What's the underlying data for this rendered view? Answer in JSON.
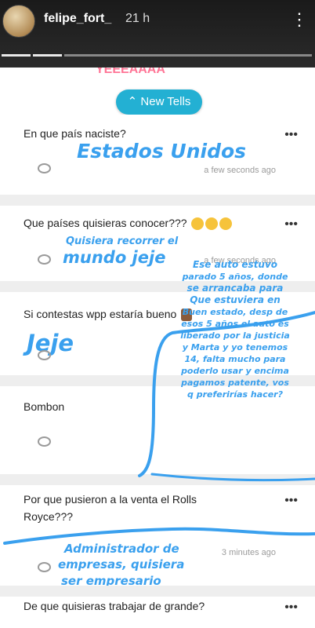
{
  "header": {
    "username": "felipe_fort_",
    "time": "21 h",
    "more_icon": "⋮"
  },
  "feed": {
    "top_fragment": "YEEEAAAA",
    "new_tells_label": "New Tells",
    "more_icon": "•••",
    "items": [
      {
        "question": "En que país naciste?",
        "answer": "Estados Unidos",
        "timestamp": "a few seconds ago"
      },
      {
        "question": "Que países quisieras conocer???",
        "answer_line1": "Quisiera recorrer el",
        "answer_line2": "mundo jeje",
        "timestamp": "a few seconds ago"
      },
      {
        "question": "Si contestas wpp estaría bueno",
        "answer": "Jeje"
      },
      {
        "question": "Bombon"
      },
      {
        "question_line1": "Por que pusieron a la venta el Rolls",
        "question_line2": "Royce???",
        "answer_line1": "Administrador de",
        "answer_line2": "empresas, quisiera",
        "answer_line3": "ser empresario",
        "timestamp": "3 minutes ago"
      },
      {
        "question": "De que quisieras trabajar de grande?"
      }
    ],
    "overlay_note": {
      "line1": "Ese auto estuvo",
      "line2": "parado 5 años, donde",
      "line3": "se arrancaba para",
      "line4": "Que estuviera en",
      "line5": "Buen estado, desp de",
      "line6": "esos 5 años el auto es",
      "line7": "liberado por la justicia",
      "line8": "y Marta y yo tenemos",
      "line9": "14, falta mucho para",
      "line10": "poderlo usar y encima",
      "line11": "pagamos patente, vos",
      "line12": "q preferirías hacer?"
    }
  },
  "colors": {
    "accent_button": "#23b0d3",
    "ink_blue": "#3aa0ee"
  }
}
